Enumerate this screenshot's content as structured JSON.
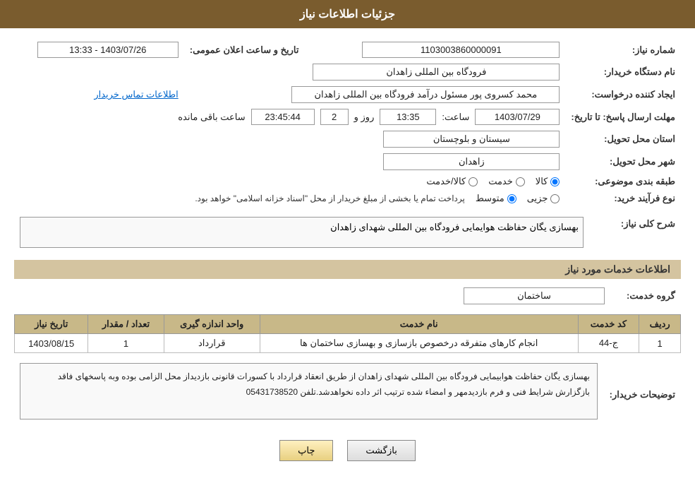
{
  "header": {
    "title": "جزئیات اطلاعات نیاز"
  },
  "sections": {
    "need_number_label": "شماره نیاز:",
    "need_number_value": "1103003860000091",
    "buyer_org_label": "نام دستگاه خریدار:",
    "buyer_org_value": "فرودگاه بین المللی زاهدان",
    "creator_label": "ایجاد کننده درخواست:",
    "creator_value": "محمد کسروی پور مسئول درآمد فرودگاه بین المللی زاهدان",
    "creator_link": "اطلاعات تماس خریدار",
    "send_deadline_label": "مهلت ارسال پاسخ: تا تاریخ:",
    "date_value": "1403/07/29",
    "time_label": "ساعت:",
    "time_value": "13:35",
    "days_label": "روز و",
    "days_value": "2",
    "remaining_label": "ساعت باقی مانده",
    "remaining_value": "23:45:44",
    "public_announce_label": "تاریخ و ساعت اعلان عمومی:",
    "public_announce_value": "1403/07/26 - 13:33",
    "province_label": "استان محل تحویل:",
    "province_value": "سیستان و بلوچستان",
    "city_label": "شهر محل تحویل:",
    "city_value": "زاهدان",
    "category_label": "طبقه بندی موضوعی:",
    "category_options": [
      {
        "label": "کالا",
        "value": "kala",
        "selected": true
      },
      {
        "label": "خدمت",
        "value": "khedmat",
        "selected": false
      },
      {
        "label": "کالا/خدمت",
        "value": "kala_khedmat",
        "selected": false
      }
    ],
    "process_label": "نوع فرآیند خرید:",
    "process_options": [
      {
        "label": "جزیی",
        "value": "jozii",
        "selected": false
      },
      {
        "label": "متوسط",
        "value": "motavaset",
        "selected": true
      },
      {
        "label": "",
        "value": "other",
        "selected": false
      }
    ],
    "process_note": "پرداخت تمام یا بخشی از مبلغ خریدار از محل \"اسناد خزانه اسلامی\" خواهد بود.",
    "general_desc_label": "شرح کلی نیاز:",
    "general_desc_value": "بهسازی یگان حفاظت هوایمایی فرودگاه بین المللی شهدای زاهدان",
    "services_label": "اطلاعات خدمات مورد نیاز",
    "service_group_label": "گروه خدمت:",
    "service_group_value": "ساختمان",
    "table": {
      "headers": [
        "ردیف",
        "کد خدمت",
        "نام خدمت",
        "واحد اندازه گیری",
        "تعداد / مقدار",
        "تاریخ نیاز"
      ],
      "rows": [
        {
          "row_num": "1",
          "code": "ج-44",
          "name": "انجام کارهای متفرقه درخصوص بازسازی و بهسازی ساختمان ها",
          "unit": "قرارداد",
          "quantity": "1",
          "date": "1403/08/15"
        }
      ]
    },
    "buyer_desc_label": "توضیحات خریدار:",
    "buyer_desc_value": "بهسازی یگان حفاظت هوابیمایی فرودگاه بین المللی شهدای زاهدان از طریق انعقاد قرارداد با کسورات قانونی بازدیداز محل الزامی بوده وبه پاسخهای فاقد بازگزارش شرایط فنی و فرم بازدیدمهر و امضاء شده ترتیب اثر داده نخواهدشد.تلفن 05431738520",
    "buttons": {
      "back_label": "بازگشت",
      "print_label": "چاپ"
    }
  }
}
